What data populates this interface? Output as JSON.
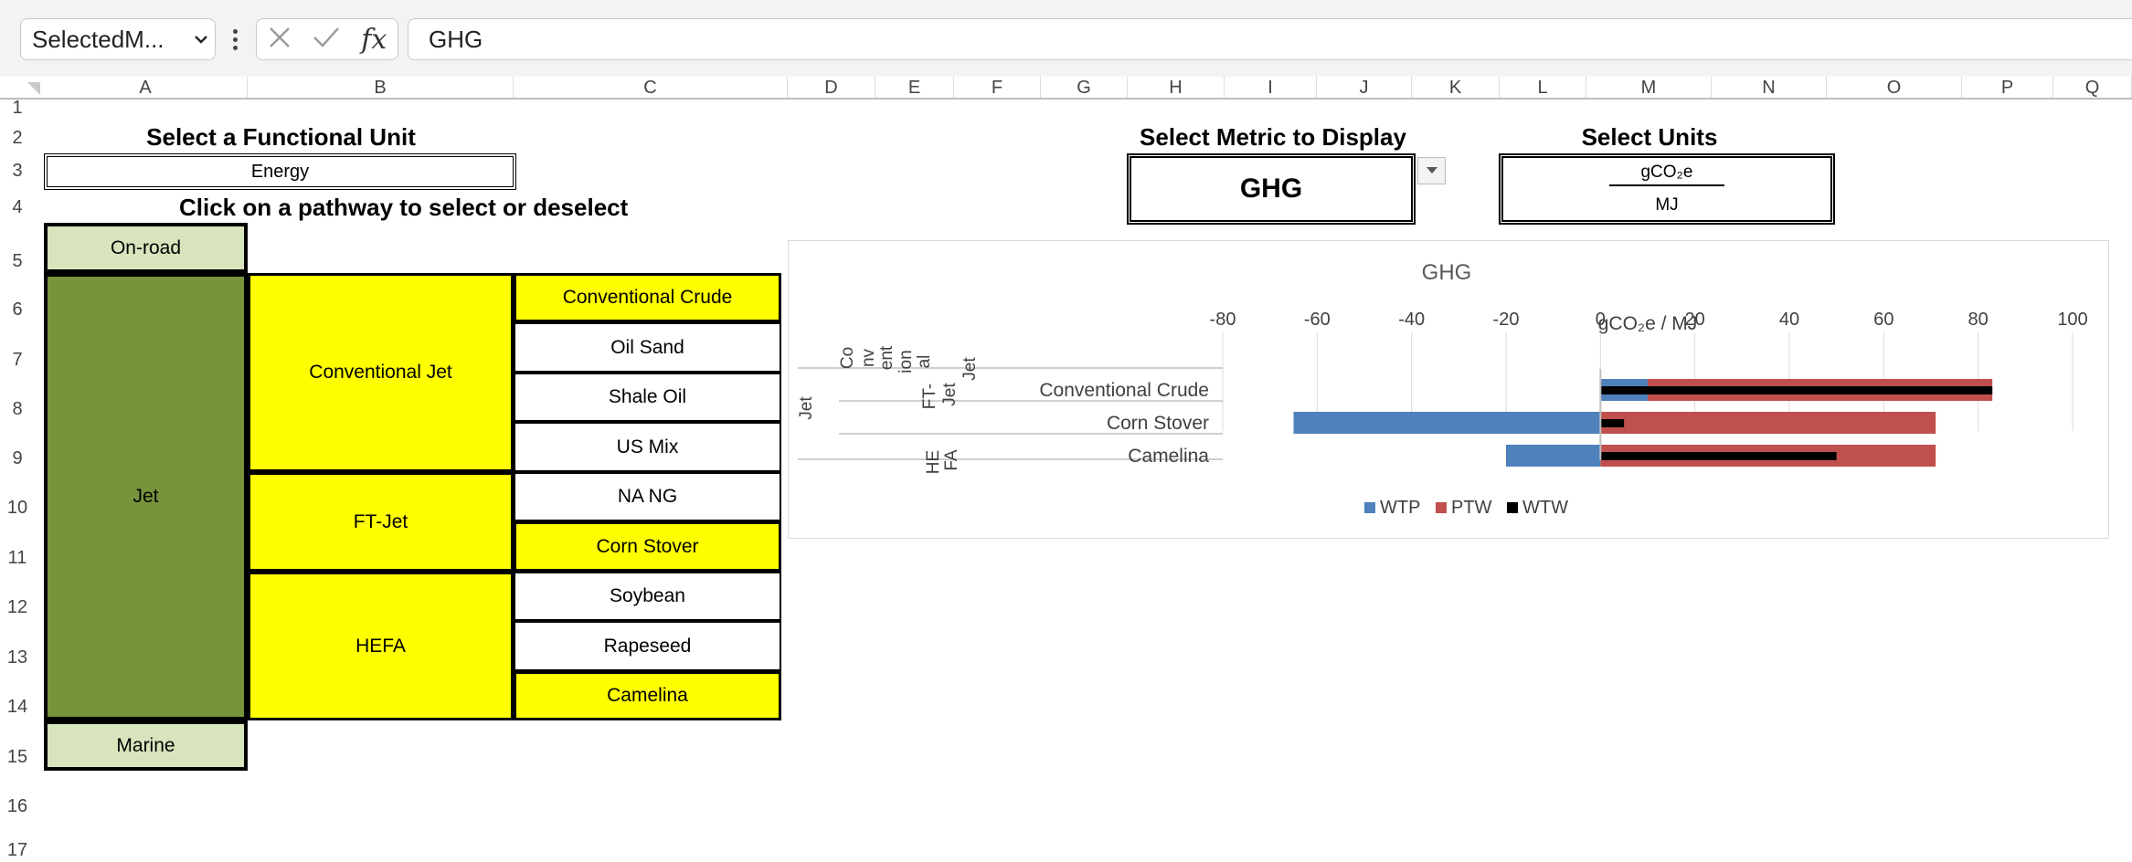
{
  "formula_bar": {
    "name_box": "SelectedM...",
    "formula": "GHG"
  },
  "columns": [
    "A",
    "B",
    "C",
    "D",
    "E",
    "F",
    "G",
    "H",
    "I",
    "J",
    "K",
    "L",
    "M",
    "N",
    "O",
    "P",
    "Q"
  ],
  "rows": [
    "1",
    "2",
    "3",
    "4",
    "5",
    "6",
    "7",
    "8",
    "9",
    "10",
    "11",
    "12",
    "13",
    "14",
    "15",
    "16",
    "17"
  ],
  "functional_unit": {
    "title": "Select a Functional Unit",
    "value": "Energy",
    "instruction": "Click on a pathway to select or deselect"
  },
  "metric": {
    "title": "Select Metric to Display",
    "value": "GHG"
  },
  "units": {
    "title": "Select Units",
    "numerator": "gCO₂e",
    "denominator": "MJ"
  },
  "pathways": {
    "onroad": "On-road",
    "jet": "Jet",
    "marine": "Marine",
    "conventional_jet": "Conventional Jet",
    "ft_jet": "FT-Jet",
    "hefa": "HEFA",
    "feedstocks": [
      "Conventional Crude",
      "Oil Sand",
      "Shale Oil",
      "US Mix",
      "NA NG",
      "Corn Stover",
      "Soybean",
      "Rapeseed",
      "Camelina"
    ]
  },
  "chart_data": {
    "type": "bar",
    "orientation": "horizontal",
    "title": "GHG",
    "xlabel": "gCO₂e / MJ",
    "xlim": [
      -80,
      100
    ],
    "xticks": [
      -80,
      -60,
      -40,
      -20,
      0,
      20,
      40,
      60,
      80,
      100
    ],
    "grid": true,
    "legend_position": "bottom",
    "outer_category": "Jet",
    "groups": [
      {
        "label_lines": [
          "Co",
          "nv",
          "ent",
          "ion",
          "al"
        ],
        "categories": [
          "Conventional Crude"
        ]
      },
      {
        "label_lines": [
          "FT-",
          "Jet"
        ],
        "categories": [
          "Corn Stover"
        ]
      },
      {
        "label_lines": [
          "HE",
          "FA",
          "Jet"
        ],
        "categories": [
          "Camelina"
        ]
      }
    ],
    "categories": [
      "Conventional Crude",
      "Corn Stover",
      "Camelina"
    ],
    "series": [
      {
        "name": "WTP",
        "color": "#4f81bd",
        "values": [
          10,
          -65,
          -20
        ]
      },
      {
        "name": "PTW",
        "color": "#c0504d",
        "values": [
          73,
          71,
          71
        ]
      },
      {
        "name": "WTW",
        "color": "#000000",
        "values": [
          83,
          5,
          50
        ]
      }
    ]
  }
}
